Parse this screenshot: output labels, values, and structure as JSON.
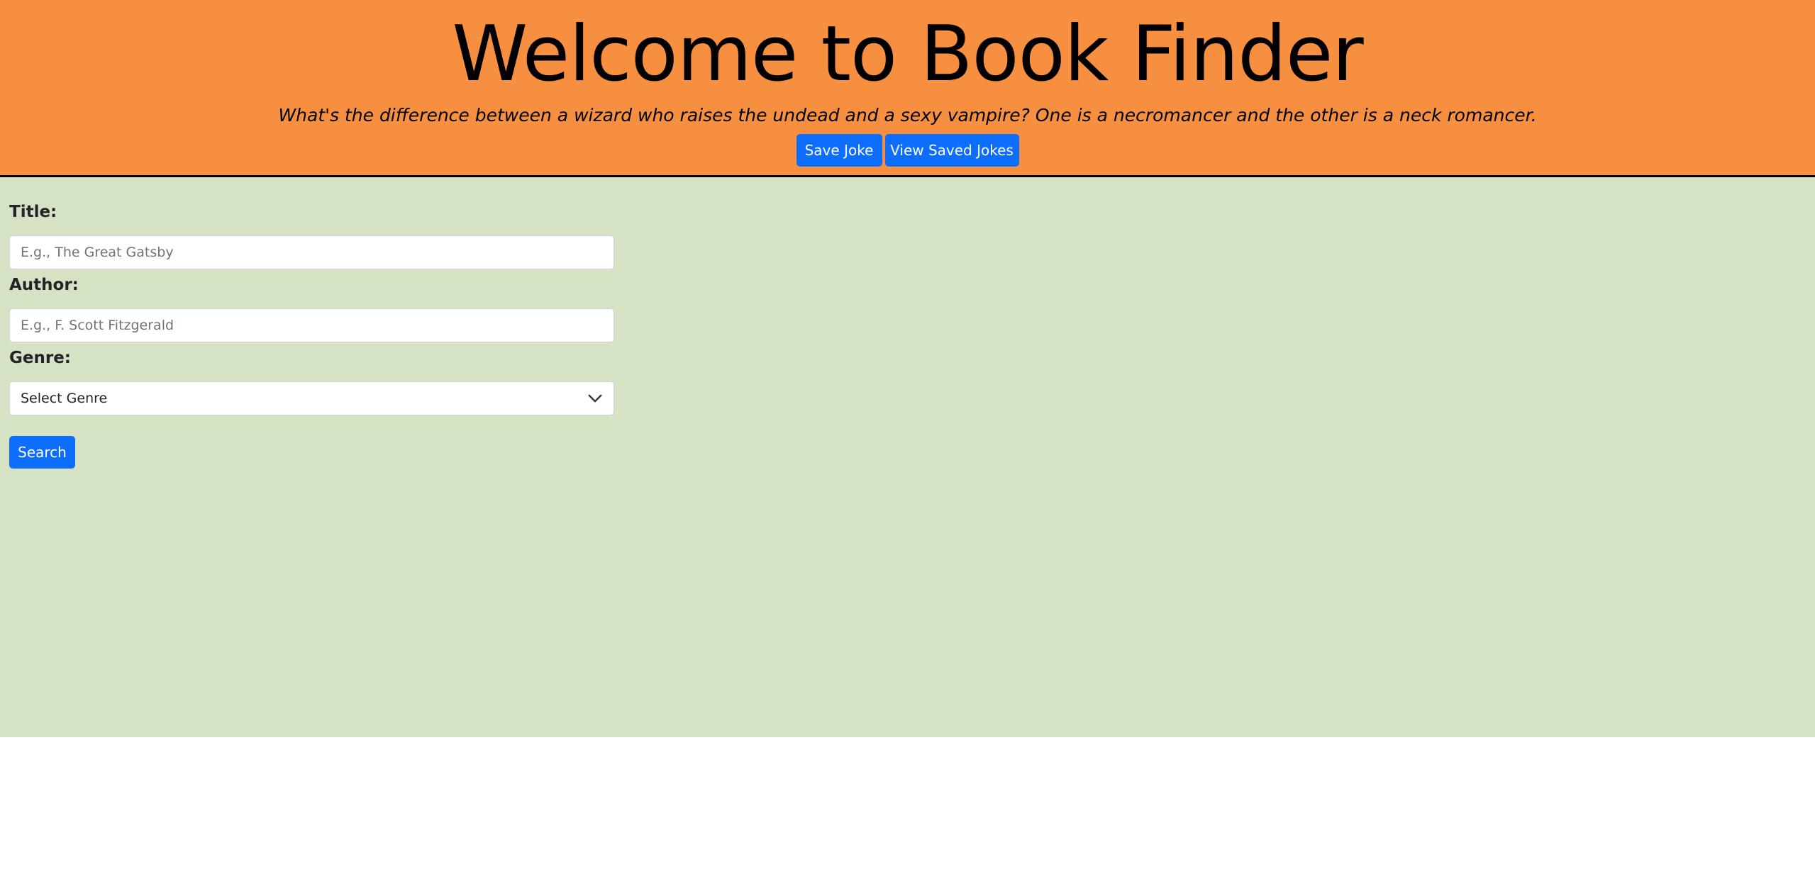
{
  "header": {
    "title": "Welcome to Book Finder",
    "joke": "What's the difference between a wizard who raises the undead and a sexy vampire? One is a necromancer and the other is a neck romancer.",
    "save_joke_label": "Save Joke",
    "view_saved_label": "View Saved Jokes"
  },
  "form": {
    "title_label": "Title:",
    "title_placeholder": "E.g., The Great Gatsby",
    "title_value": "",
    "author_label": "Author:",
    "author_placeholder": "E.g., F. Scott Fitzgerald",
    "author_value": "",
    "genre_label": "Genre:",
    "genre_selected": "Select Genre",
    "search_label": "Search"
  },
  "icons": {
    "genre_dropdown": "chevron-down-icon"
  },
  "colors": {
    "header_bg": "#f68f3f",
    "main_bg": "#d5e3c4",
    "primary_button": "#0d6efd"
  }
}
